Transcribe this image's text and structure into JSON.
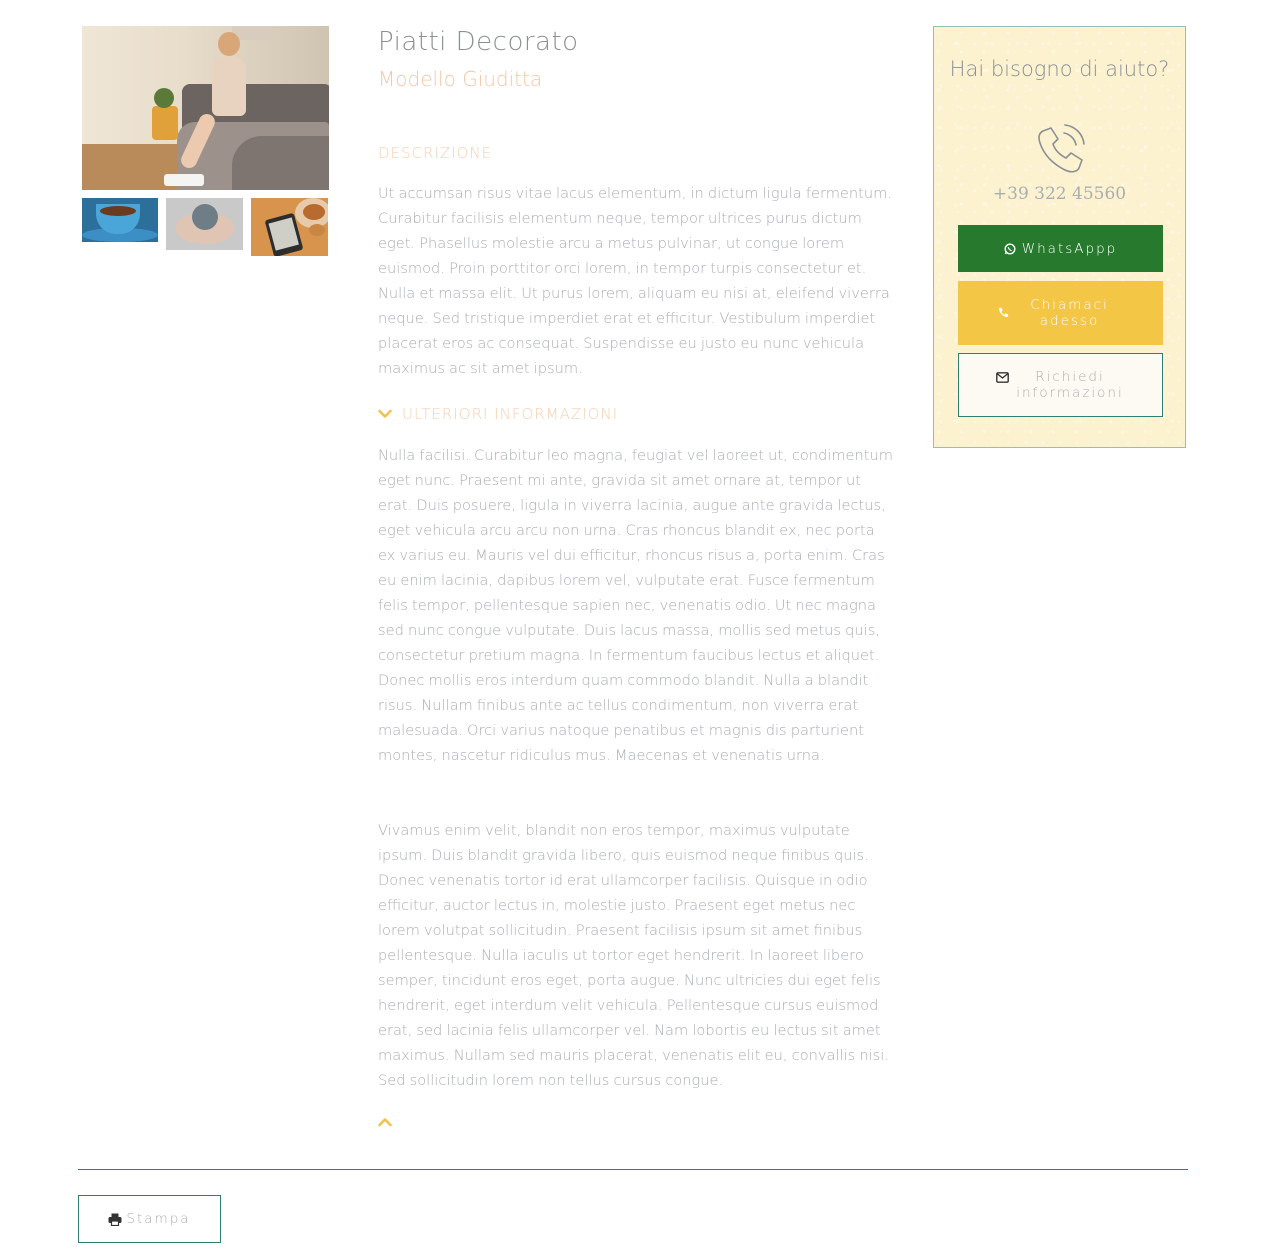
{
  "product": {
    "title": "Piatti Decorato",
    "subtitle": "Modello Giuditta"
  },
  "gallery": {
    "main_image": "woman-on-bed-with-scale-photo",
    "thumbnails": [
      "coffee-cup-photo",
      "hands-holding-ball-photo",
      "ereader-and-donuts-photo"
    ]
  },
  "description": {
    "label": "DESCRIZIONE",
    "text": "Ut accumsan risus vitae lacus elementum, in dictum ligula fermentum. Curabitur facilisis elementum neque, tempor ultrices purus dictum eget. Phasellus molestie arcu a metus pulvinar, ut congue lorem euismod. Proin porttitor orci lorem, in tempor turpis consectetur et. Nulla et massa elit. Ut purus lorem, aliquam eu nisi at, eleifend viverra neque. Sed tristique imperdiet erat et efficitur. Vestibulum imperdiet placerat eros ac consequat. Suspendisse eu justo eu nunc vehicula maximus ac sit amet ipsum."
  },
  "more_info": {
    "label": "ULTERIORI INFORMAZIONI",
    "paragraph_1": "Nulla facilisi. Curabitur leo magna, feugiat vel laoreet ut, condimentum eget nunc. Praesent mi ante, gravida sit amet ornare at, tempor ut erat. Duis posuere, ligula in viverra lacinia, augue ante gravida lectus, eget vehicula arcu arcu non urna. Cras rhoncus blandit ex, nec porta ex varius eu. Mauris vel dui efficitur, rhoncus risus a, porta enim. Cras eu enim lacinia, dapibus lorem vel, vulputate erat. Fusce fermentum felis tempor, pellentesque sapien nec, venenatis odio. Ut nec magna sed nunc congue vulputate. Duis lacus massa, mollis sed metus quis, consectetur pretium magna. In fermentum faucibus lectus et aliquet. Donec mollis eros interdum quam commodo blandit. Nulla a blandit risus. Nullam finibus ante ac tellus condimentum, non viverra erat malesuada. Orci varius natoque penatibus et magnis dis parturient montes, nascetur ridiculus mus. Maecenas et venenatis urna.",
    "paragraph_2": "Vivamus enim velit, blandit non eros tempor, maximus vulputate ipsum. Duis blandit gravida libero, quis euismod neque finibus quis. Donec venenatis tortor id erat ullamcorper facilisis. Quisque in odio efficitur, auctor lectus in, molestie justo. Praesent eget metus nec lorem volutpat sollicitudin. Praesent facilisis ipsum sit amet finibus pellentesque. Nulla iaculis ut tortor eget hendrerit. In laoreet libero semper, tincidunt eros eget, porta augue. Nunc ultricies dui eget felis hendrerit, eget interdum velit vehicula. Pellentesque cursus euismod erat, sed lacinia felis ullamcorper vel. Nam lobortis eu lectus sit amet maximus. Nullam sed mauris placerat, venenatis elit eu, convallis nisi. Sed sollicitudin lorem non tellus cursus congue."
  },
  "help": {
    "title": "Hai bisogno di aiuto?",
    "phone": "+39 322 45560",
    "whatsapp_label": "WhatsAppp",
    "call_label": "Chiamaci adesso",
    "info_label": "Richiedi informazioni"
  },
  "footer": {
    "print_label": "Stampa"
  },
  "colors": {
    "accent_orange": "#f3c24f",
    "title_peach": "#f4c6a7",
    "whatsapp_green": "#277a2d",
    "call_yellow": "#f4c646",
    "border_teal": "#2d7f76",
    "help_bg": "#fdf2d0"
  },
  "icons": {
    "whatsapp": "whatsapp-icon",
    "call": "phone-icon",
    "info": "envelope-icon",
    "print": "printer-icon",
    "expand": "chevron-down-icon",
    "collapse": "chevron-up-icon"
  }
}
